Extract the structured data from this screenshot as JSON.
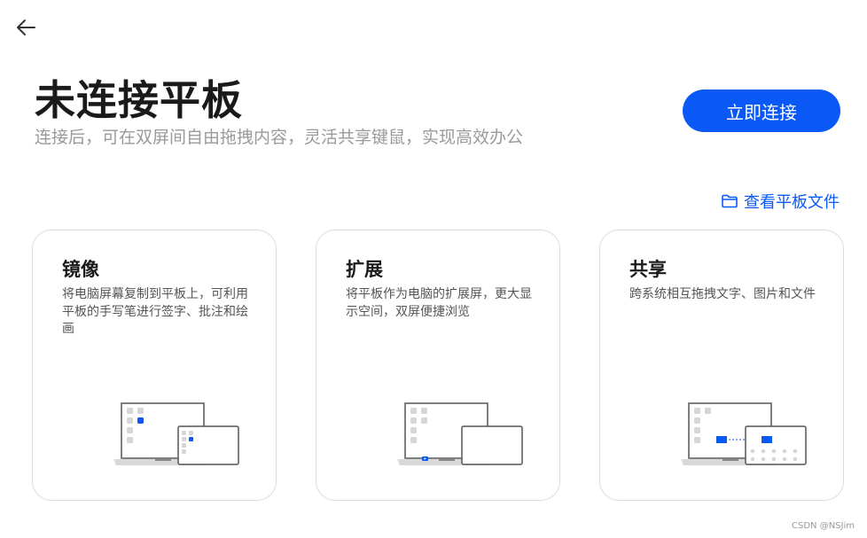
{
  "header": {
    "title": "未连接平板",
    "subtitle": "连接后，可在双屏间自由拖拽内容，灵活共享键鼠，实现高效办公",
    "connect_label": "立即连接",
    "files_link": "查看平板文件"
  },
  "cards": [
    {
      "title": "镜像",
      "desc": "将电脑屏幕复制到平板上，可利用平板的手写笔进行签字、批注和绘画"
    },
    {
      "title": "扩展",
      "desc": "将平板作为电脑的扩展屏，更大显示空间，双屏便捷浏览"
    },
    {
      "title": "共享",
      "desc": "跨系统相互拖拽文字、图片和文件"
    }
  ],
  "watermark": "CSDN @NSJim",
  "colors": {
    "accent": "#0a59f7",
    "title": "#1a1a1a",
    "subtitle": "#9a9a9a",
    "card_border": "#dcdcdc"
  },
  "icons": {
    "back": "arrow-left-icon",
    "folder": "folder-icon"
  }
}
